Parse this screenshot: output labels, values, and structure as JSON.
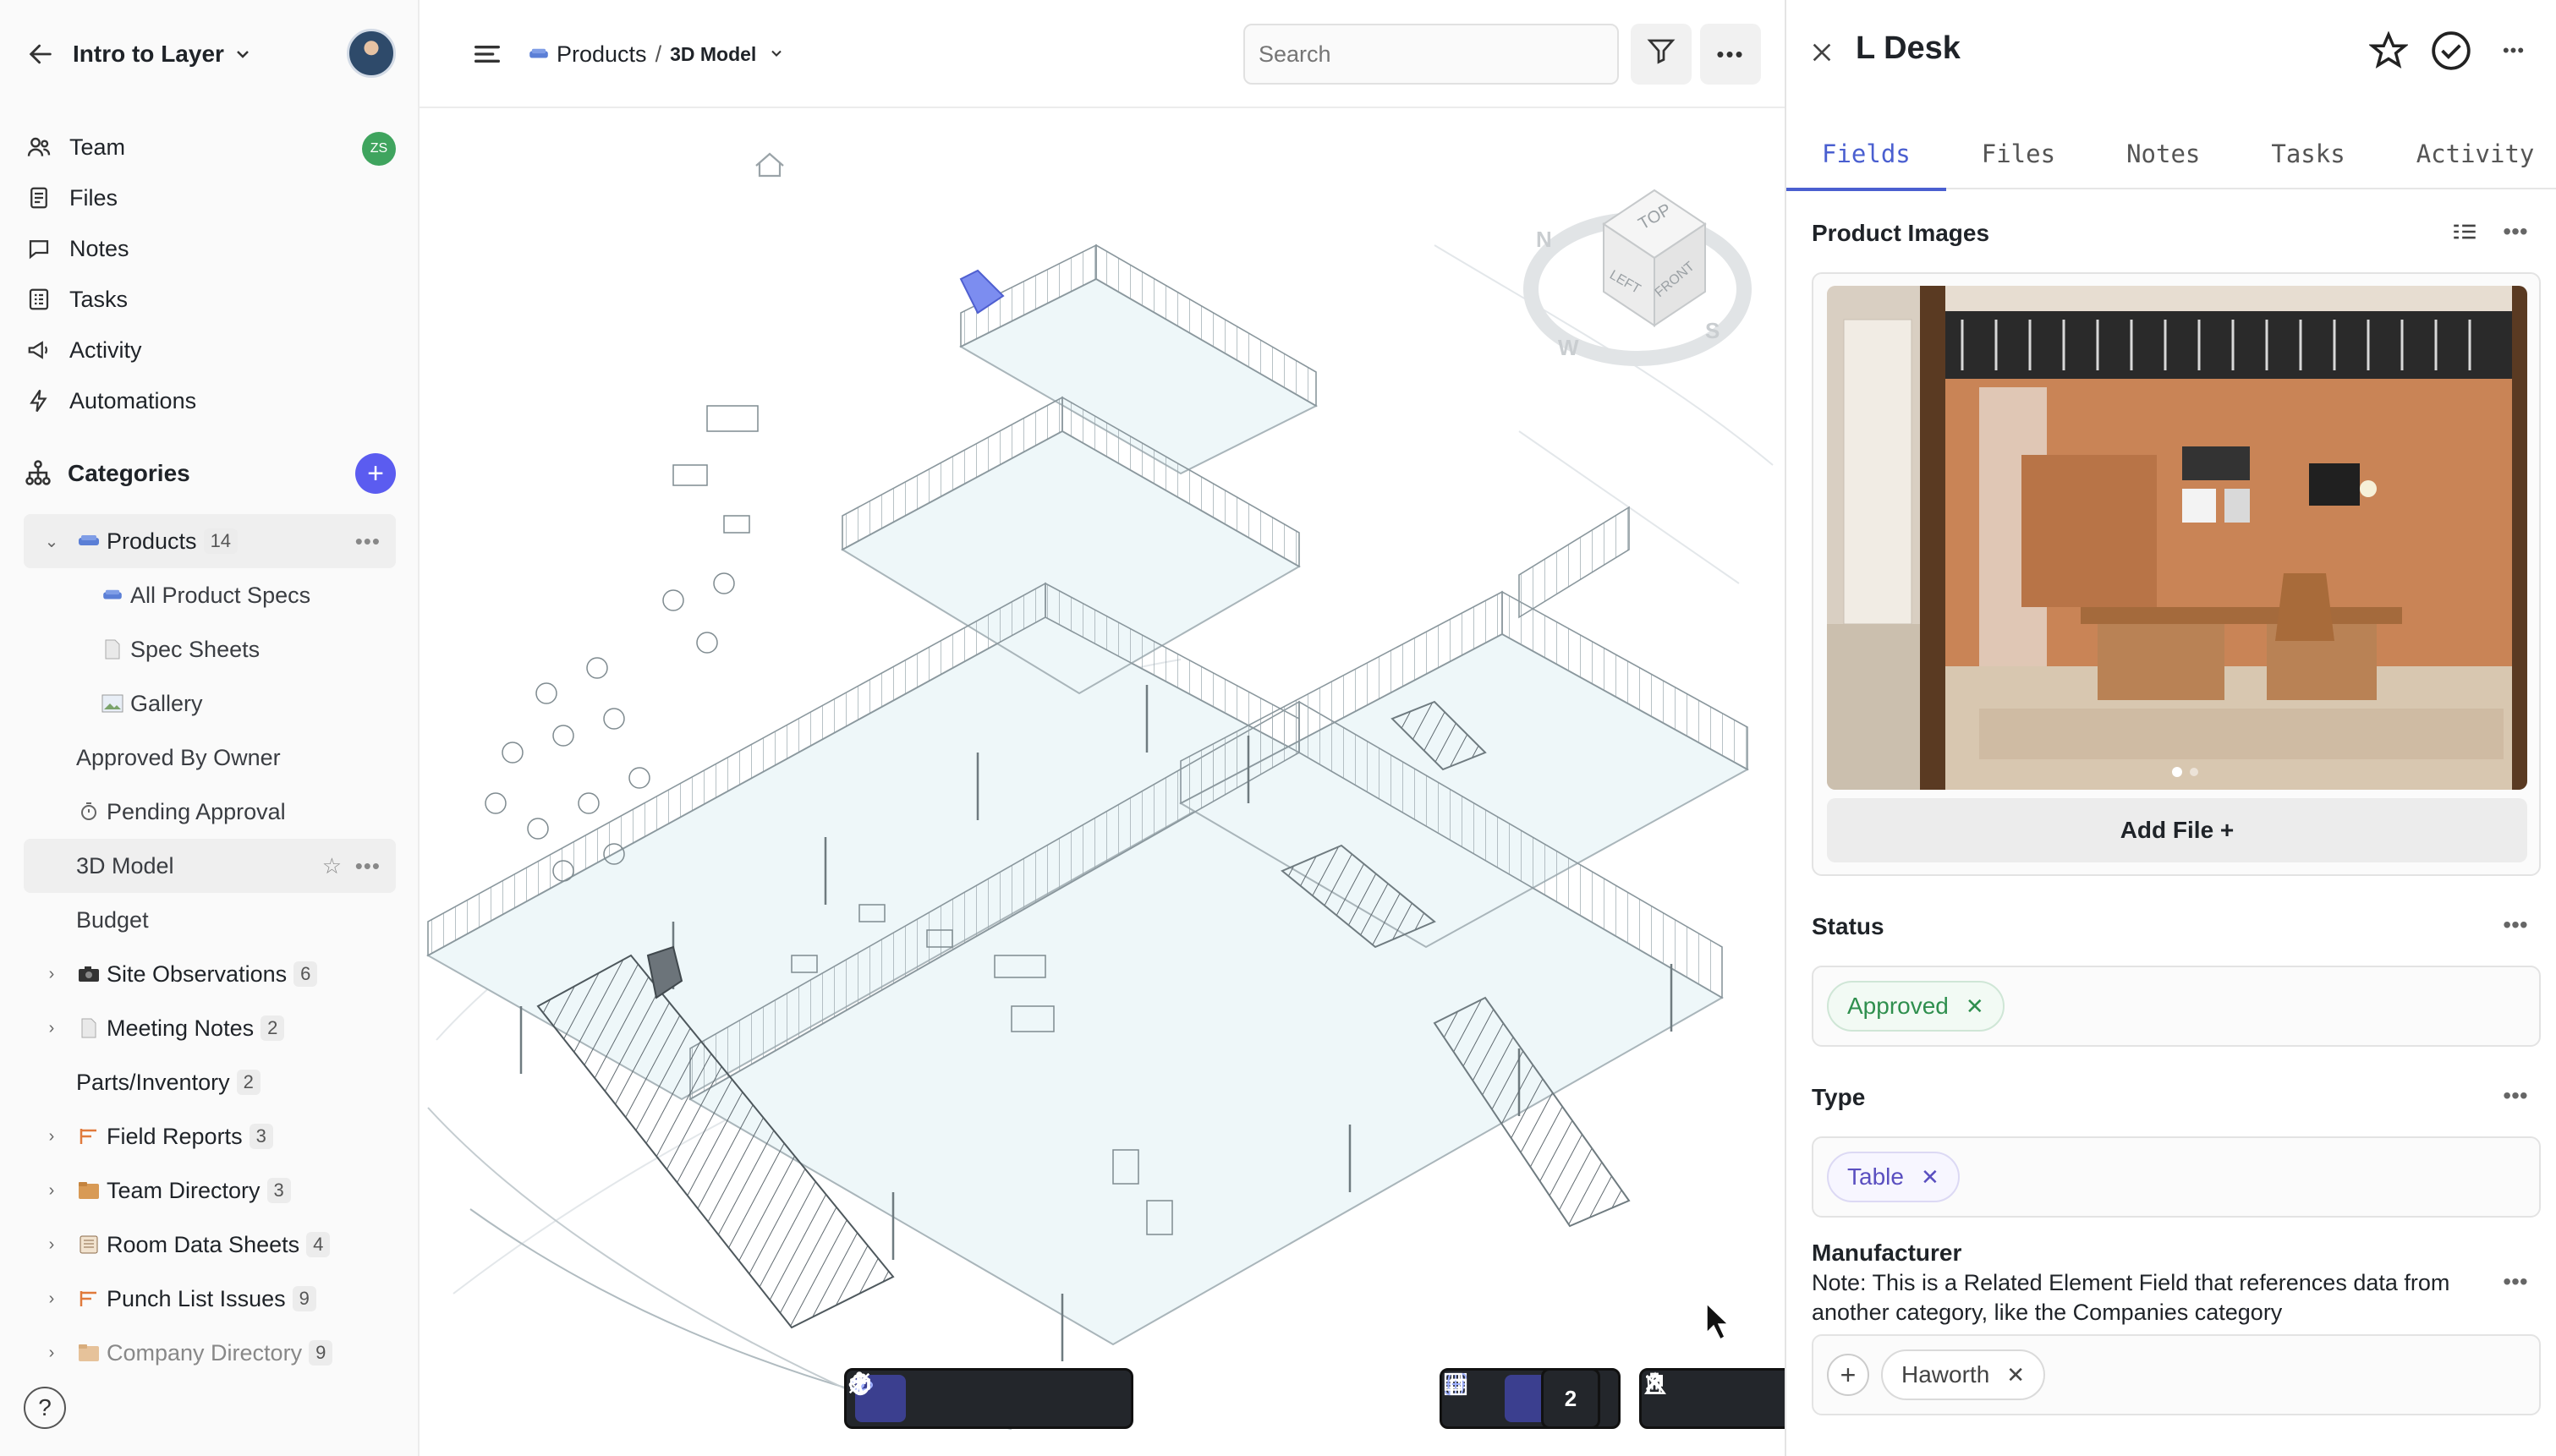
{
  "workspace": {
    "title": "Intro to Layer"
  },
  "nav": [
    {
      "label": "Team",
      "badge": "ZS"
    },
    {
      "label": "Files"
    },
    {
      "label": "Notes"
    },
    {
      "label": "Tasks"
    },
    {
      "label": "Activity"
    },
    {
      "label": "Automations"
    }
  ],
  "categories": {
    "title": "Categories",
    "products": {
      "label": "Products",
      "count": "14"
    },
    "product_views": [
      "All Product Specs",
      "Spec Sheets",
      "Gallery",
      "Approved By Owner",
      "Pending Approval",
      "3D Model",
      "Budget"
    ],
    "others": [
      {
        "label": "Site Observations",
        "count": "6"
      },
      {
        "label": "Meeting Notes",
        "count": "2"
      },
      {
        "label": "Parts/Inventory",
        "count": "2"
      },
      {
        "label": "Field Reports",
        "count": "3"
      },
      {
        "label": "Team Directory",
        "count": "3"
      },
      {
        "label": "Room Data Sheets",
        "count": "4"
      },
      {
        "label": "Punch List Issues",
        "count": "9"
      },
      {
        "label": "Company Directory",
        "count": "9"
      }
    ]
  },
  "topbar": {
    "breadcrumb_parent": "Products",
    "breadcrumb_sep": "/",
    "breadcrumb_current": "3D Model",
    "search_placeholder": "Search"
  },
  "viewer": {
    "selection_count": "2",
    "navcube": {
      "top": "TOP",
      "left": "LEFT",
      "front": "FRONT",
      "n": "N",
      "w": "W",
      "s": "S"
    }
  },
  "panel": {
    "title": "L Desk",
    "tabs": [
      "Fields",
      "Files",
      "Notes",
      "Tasks",
      "Activity"
    ],
    "active_tab": "Fields",
    "product_images_label": "Product Images",
    "add_file_label": "Add File +",
    "status_label": "Status",
    "status_value": "Approved",
    "type_label": "Type",
    "type_value": "Table",
    "manufacturer_label": "Manufacturer",
    "manufacturer_note": "Note: This is a Related Element Field that references data from another category, like the Companies category",
    "manufacturer_value": "Haworth"
  },
  "colors": {
    "accent": "#5b5cf0",
    "tab_active": "#4a5fd0",
    "status_green": "#2f8f4e",
    "toolbar": "#23262b"
  }
}
